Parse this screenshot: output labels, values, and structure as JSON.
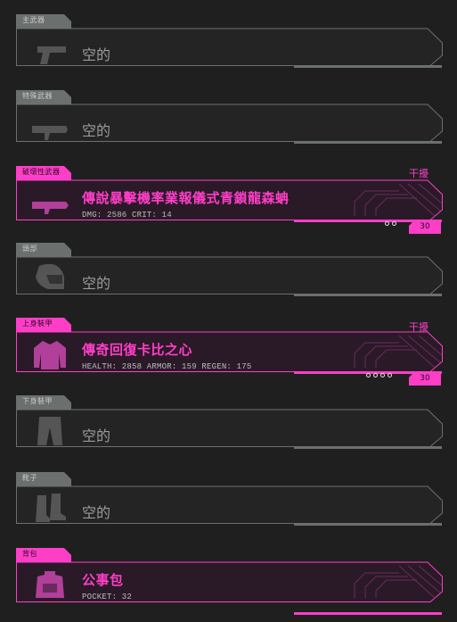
{
  "colors": {
    "normal": "#6b706e",
    "pink": "#ff3ec8",
    "panel": "#242424",
    "bg": "#1f1f1f"
  },
  "slots": [
    {
      "tag": "主武器",
      "type": "empty",
      "text": "空的",
      "icon": "pistol-icon"
    },
    {
      "tag": "特殊武器",
      "type": "empty",
      "text": "空的",
      "icon": "rocket-launcher-icon"
    },
    {
      "tag": "破壞性武器",
      "type": "item",
      "name": "傳說暴擊機率業報儀式青鎖龍森蚺",
      "stats": "DMG: 2586   CRIT: 14",
      "interfere": "干擾",
      "level": "30",
      "dots": 2,
      "icon": "rocket-weapon-icon"
    },
    {
      "tag": "頭部",
      "type": "empty",
      "text": "空的",
      "icon": "helmet-icon"
    },
    {
      "tag": "上身裝甲",
      "type": "item",
      "name": "傳奇回復卡比之心",
      "stats": "HEALTH: 2858   ARMOR: 159   REGEN: 175",
      "interfere": "干擾",
      "level": "30",
      "dots": 4,
      "icon": "jacket-icon"
    },
    {
      "tag": "下身裝甲",
      "type": "empty",
      "text": "空的",
      "icon": "pants-icon"
    },
    {
      "tag": "靴子",
      "type": "empty",
      "text": "空的",
      "icon": "boots-icon"
    },
    {
      "tag": "背包",
      "type": "item",
      "name": "公事包",
      "stats": "POCKET: 32",
      "icon": "backpack-icon"
    }
  ]
}
